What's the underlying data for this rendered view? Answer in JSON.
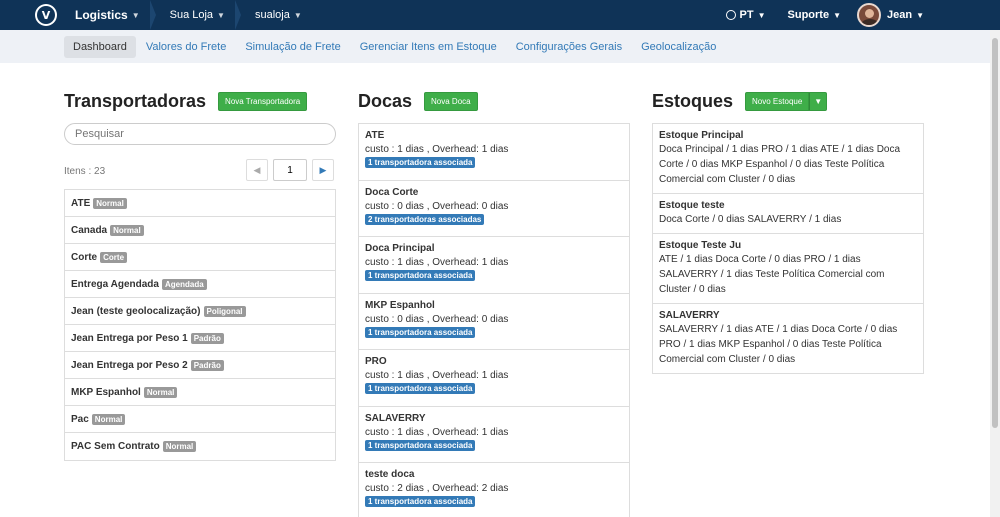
{
  "topbar": {
    "logo_letter": "V",
    "crumbs": [
      "Logistics",
      "Sua Loja",
      "sualoja"
    ],
    "language": "PT",
    "support": "Suporte",
    "user": "Jean"
  },
  "subnav": [
    "Dashboard",
    "Valores do Frete",
    "Simulação de Frete",
    "Gerenciar Itens em Estoque",
    "Configurações Gerais",
    "Geolocalização"
  ],
  "carriers": {
    "title": "Transportadoras",
    "new_button": "Nova Transportadora",
    "search_placeholder": "Pesquisar",
    "items_count": "Itens : 23",
    "page": "1",
    "list": [
      {
        "name": "ATE",
        "tag": "Normal"
      },
      {
        "name": "Canada",
        "tag": "Normal"
      },
      {
        "name": "Corte",
        "tag": "Corte"
      },
      {
        "name": "Entrega Agendada",
        "tag": "Agendada"
      },
      {
        "name": "Jean (teste geolocalização)",
        "tag": "Poligonal"
      },
      {
        "name": "Jean Entrega por Peso 1",
        "tag": "Padrão"
      },
      {
        "name": "Jean Entrega por Peso 2",
        "tag": "Padrão"
      },
      {
        "name": "MKP Espanhol",
        "tag": "Normal"
      },
      {
        "name": "Pac",
        "tag": "Normal"
      },
      {
        "name": "PAC Sem Contrato",
        "tag": "Normal"
      }
    ]
  },
  "docks": {
    "title": "Docas",
    "new_button": "Nova Doca",
    "list": [
      {
        "name": "ATE",
        "cost": "custo : 1 dias , Overhead: 1 dias",
        "tag": "1 transportadora associada"
      },
      {
        "name": "Doca Corte",
        "cost": "custo : 0 dias , Overhead: 0 dias",
        "tag": "2 transportadoras associadas"
      },
      {
        "name": "Doca Principal",
        "cost": "custo : 1 dias , Overhead: 1 dias",
        "tag": "1 transportadora associada"
      },
      {
        "name": "MKP Espanhol",
        "cost": "custo : 0 dias , Overhead: 0 dias",
        "tag": "1 transportadora associada"
      },
      {
        "name": "PRO",
        "cost": "custo : 1 dias , Overhead: 1 dias",
        "tag": "1 transportadora associada"
      },
      {
        "name": "SALAVERRY",
        "cost": "custo : 1 dias , Overhead: 1 dias",
        "tag": "1 transportadora associada"
      },
      {
        "name": "teste doca",
        "cost": "custo : 2 dias , Overhead: 2 dias",
        "tag": "1 transportadora associada"
      }
    ]
  },
  "stocks": {
    "title": "Estoques",
    "new_button": "Novo Estoque",
    "list": [
      {
        "name": "Estoque Principal",
        "desc": "Doca Principal / 1 dias PRO / 1 dias ATE / 1 dias Doca Corte / 0 dias MKP Espanhol / 0 dias Teste Política Comercial com Cluster / 0 dias"
      },
      {
        "name": "Estoque teste",
        "desc": "Doca Corte / 0 dias SALAVERRY / 1 dias"
      },
      {
        "name": "Estoque Teste Ju",
        "desc": "ATE / 1 dias Doca Corte / 0 dias PRO / 1 dias SALAVERRY / 1 dias Teste Política Comercial com Cluster / 0 dias"
      },
      {
        "name": "SALAVERRY",
        "desc": "SALAVERRY / 1 dias ATE / 1 dias Doca Corte / 0 dias PRO / 1 dias MKP Espanhol / 0 dias Teste Política Comercial com Cluster / 0 dias"
      }
    ]
  }
}
